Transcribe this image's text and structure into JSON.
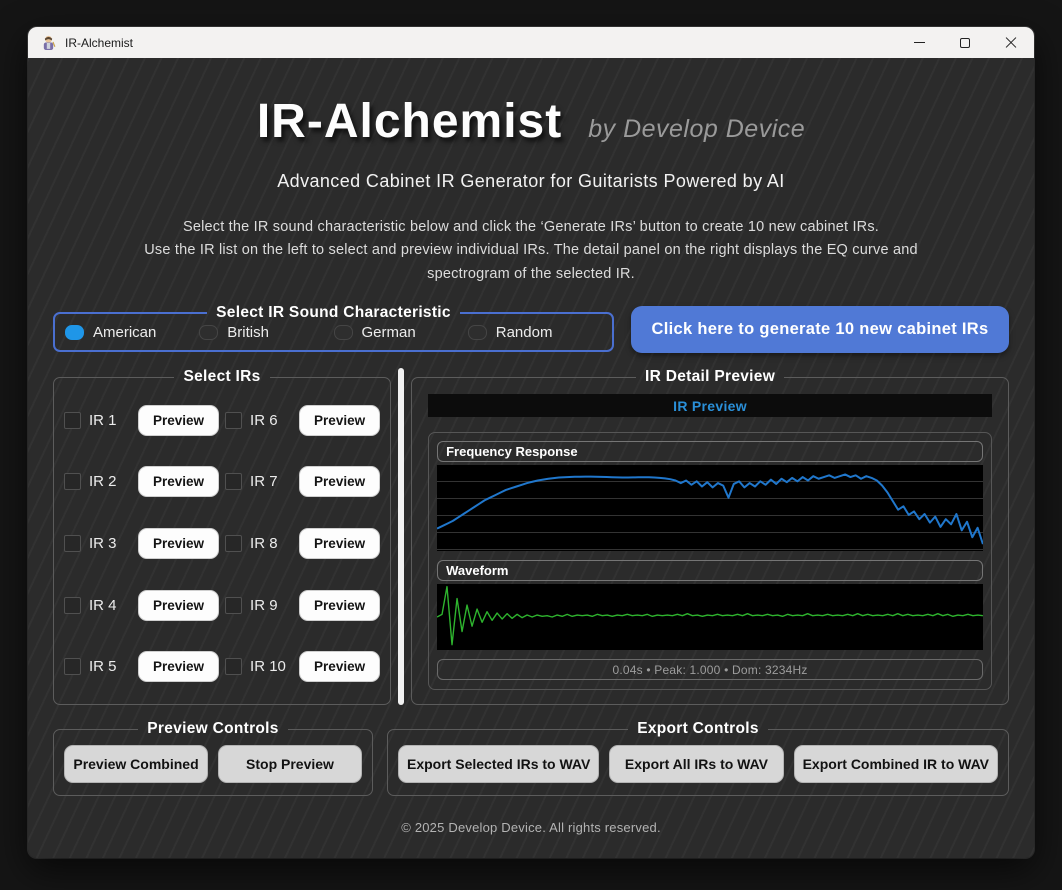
{
  "window": {
    "title": "IR-Alchemist"
  },
  "header": {
    "title": "IR-Alchemist",
    "byline": "by Develop Device",
    "subtitle": "Advanced Cabinet IR Generator for Guitarists Powered by AI",
    "description_line1": "Select the IR sound characteristic below and click the ‘Generate IRs’ button to create 10 new cabinet IRs.",
    "description_line2": "Use the IR list on the left to select and preview individual IRs. The detail panel on the right displays the EQ curve and",
    "description_line3": "spectrogram of the selected IR."
  },
  "characteristic": {
    "legend": "Select IR Sound Characteristic",
    "options": [
      {
        "label": "American",
        "selected": true
      },
      {
        "label": "British",
        "selected": false
      },
      {
        "label": "German",
        "selected": false
      },
      {
        "label": "Random",
        "selected": false
      }
    ]
  },
  "generate": {
    "label": "Click here to generate 10 new cabinet IRs"
  },
  "ir_list": {
    "legend": "Select IRs",
    "preview_label": "Preview",
    "items": [
      {
        "label": "IR 1",
        "checked": false
      },
      {
        "label": "IR 2",
        "checked": false
      },
      {
        "label": "IR 3",
        "checked": false
      },
      {
        "label": "IR 4",
        "checked": false
      },
      {
        "label": "IR 5",
        "checked": false
      },
      {
        "label": "IR 6",
        "checked": false
      },
      {
        "label": "IR 7",
        "checked": false
      },
      {
        "label": "IR 8",
        "checked": false
      },
      {
        "label": "IR 9",
        "checked": false
      },
      {
        "label": "IR 10",
        "checked": false
      }
    ]
  },
  "detail": {
    "legend": "IR Detail Preview",
    "banner": "IR Preview",
    "freq_label": "Frequency Response",
    "wave_label": "Waveform",
    "status": "0.04s • Peak: 1.000 • Dom: 3234Hz"
  },
  "preview_controls": {
    "legend": "Preview Controls",
    "combined_label": "Preview Combined",
    "stop_label": "Stop Preview"
  },
  "export_controls": {
    "legend": "Export Controls",
    "selected_label": "Export Selected IRs to WAV",
    "all_label": "Export All IRs to WAV",
    "combined_label": "Export Combined IR to WAV"
  },
  "footer": {
    "copyright": "© 2025 Develop Device. All rights reserved."
  },
  "colors": {
    "accent_blue": "#5079d6",
    "radio_selected": "#1f96e8",
    "banner_text": "#2a8fd8",
    "freq_line": "#2077cc",
    "wave_line": "#2eb42e",
    "chart_bg": "#000000",
    "panel_bg": "#2b2b2b",
    "titlebar_bg": "#f3f2f1"
  },
  "chart_data": [
    {
      "type": "line",
      "title": "Frequency Response",
      "xlabel": "",
      "ylabel": "",
      "legend": "none",
      "grid": "horizontal",
      "color": "#2077cc",
      "note": "unlabeled magnitude curve; values are percent-from-top of plot at evenly spaced x",
      "values": [
        74,
        71,
        68,
        65,
        61,
        57,
        53,
        49,
        45,
        41,
        38,
        35,
        32,
        29,
        27,
        25,
        23,
        21,
        19.5,
        18,
        17,
        16,
        15.2,
        14.6,
        14.2,
        13.9,
        13.7,
        13.6,
        13.5,
        13.5,
        13.6,
        13.8,
        14,
        14.2,
        14.4,
        14.5,
        14.5,
        14.4,
        14.3,
        14.2,
        14.3,
        14.6,
        15,
        15.6,
        16.5,
        18,
        21,
        18,
        23,
        19,
        25,
        20,
        26,
        21,
        24,
        38,
        22,
        19,
        26,
        21,
        25,
        19,
        23,
        17,
        22,
        16,
        20,
        15,
        19,
        14,
        18,
        13,
        16,
        14,
        12,
        15,
        13,
        11,
        14,
        12,
        16,
        13,
        15,
        18,
        24,
        32,
        42,
        52,
        48,
        58,
        54,
        63,
        57,
        67,
        60,
        72,
        63,
        69,
        57,
        76,
        66,
        84,
        73,
        92
      ]
    },
    {
      "type": "line",
      "title": "Waveform",
      "xlabel": "",
      "ylabel": "",
      "legend": "none",
      "grid": "off",
      "color": "#2eb42e",
      "note": "impulse response waveform; sharp initial transient then small decaying ripple; values are percent-from-top of plot",
      "values": [
        50,
        46,
        4,
        92,
        22,
        72,
        32,
        64,
        38,
        58,
        42,
        55,
        44,
        53,
        45,
        52,
        46,
        51,
        47,
        50,
        47,
        49,
        48,
        50,
        47,
        49,
        46,
        49,
        47,
        48,
        47,
        49,
        46,
        48,
        47,
        49,
        47,
        48,
        46,
        48,
        47,
        48,
        46,
        49,
        47,
        48,
        47,
        48,
        46,
        48,
        45,
        48,
        47,
        49,
        47,
        48,
        46,
        48,
        47,
        48,
        46,
        48,
        45,
        48,
        47,
        48,
        46,
        48,
        47,
        49,
        46,
        48,
        47,
        48,
        45,
        48,
        47,
        48,
        46,
        48,
        47,
        48,
        46,
        48,
        45,
        48,
        46,
        48,
        47,
        48,
        46,
        48,
        45,
        48,
        46,
        48,
        47,
        48,
        46,
        48,
        45,
        48,
        46,
        49,
        47,
        48,
        46,
        48,
        47,
        48
      ]
    }
  ]
}
